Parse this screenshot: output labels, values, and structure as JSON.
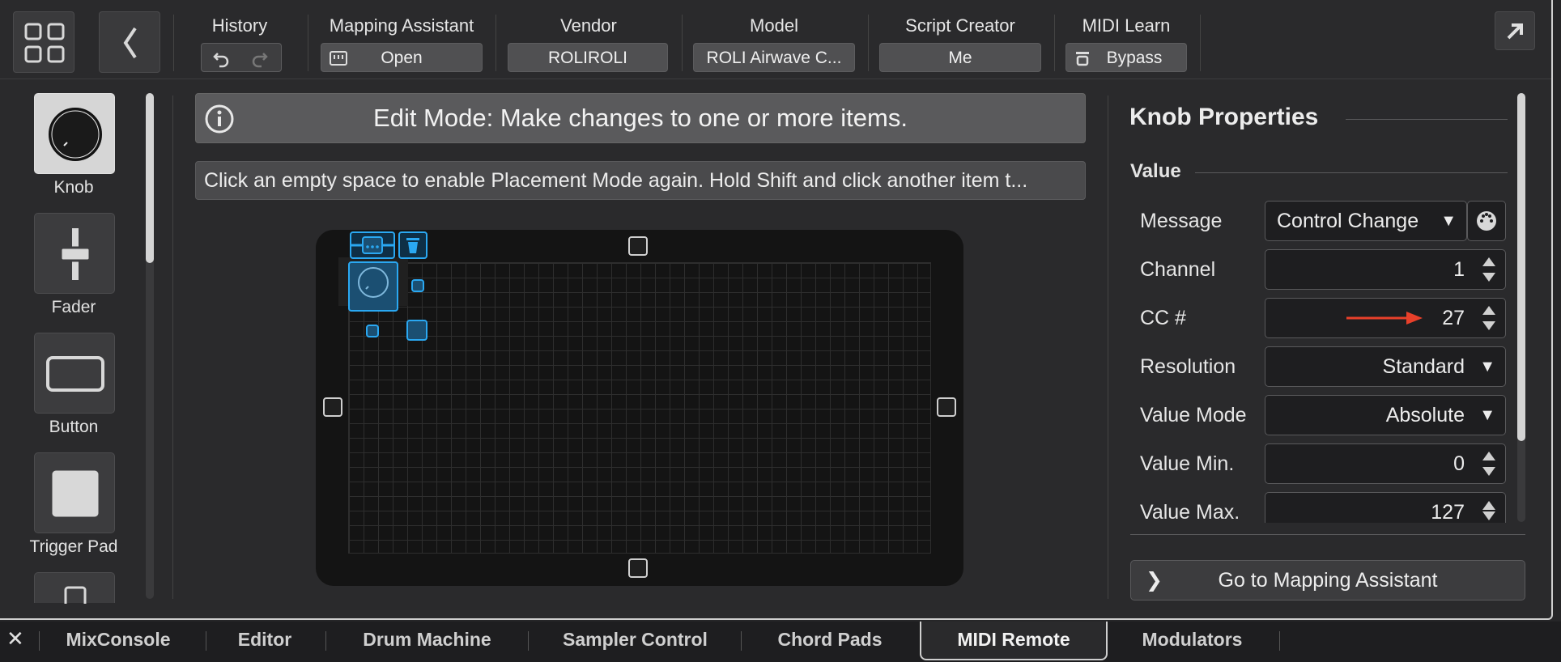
{
  "toolbar": {
    "history_label": "History",
    "mapping_label": "Mapping Assistant",
    "mapping_btn": "Open",
    "vendor_label": "Vendor",
    "vendor_value": "ROLIROLI",
    "model_label": "Model",
    "model_value": "ROLI Airwave C...",
    "script_label": "Script Creator",
    "script_value": "Me",
    "midi_label": "MIDI Learn",
    "midi_btn": "Bypass"
  },
  "palette": {
    "items": [
      {
        "label": "Knob"
      },
      {
        "label": "Fader"
      },
      {
        "label": "Button"
      },
      {
        "label": "Trigger Pad"
      }
    ]
  },
  "editor": {
    "banner": "Edit Mode: Make changes to one or more items.",
    "hint": "Click an empty space to enable Placement Mode again. Hold Shift and click another item t..."
  },
  "properties": {
    "title": "Knob Properties",
    "section": "Value",
    "rows": [
      {
        "label": "Message",
        "value": "Control Change"
      },
      {
        "label": "Channel",
        "value": "1"
      },
      {
        "label": "CC #",
        "value": "27"
      },
      {
        "label": "Resolution",
        "value": "Standard"
      },
      {
        "label": "Value Mode",
        "value": "Absolute"
      },
      {
        "label": "Value Min.",
        "value": "0"
      },
      {
        "label": "Value Max.",
        "value": "127"
      }
    ],
    "goto": "Go to Mapping Assistant"
  },
  "tabs": [
    "MixConsole",
    "Editor",
    "Drum Machine",
    "Sampler Control",
    "Chord Pads",
    "MIDI Remote",
    "Modulators"
  ],
  "active_tab": "MIDI Remote",
  "colors": {
    "accent_blue": "#2aa8f2",
    "annotation_red": "#e8402a"
  }
}
